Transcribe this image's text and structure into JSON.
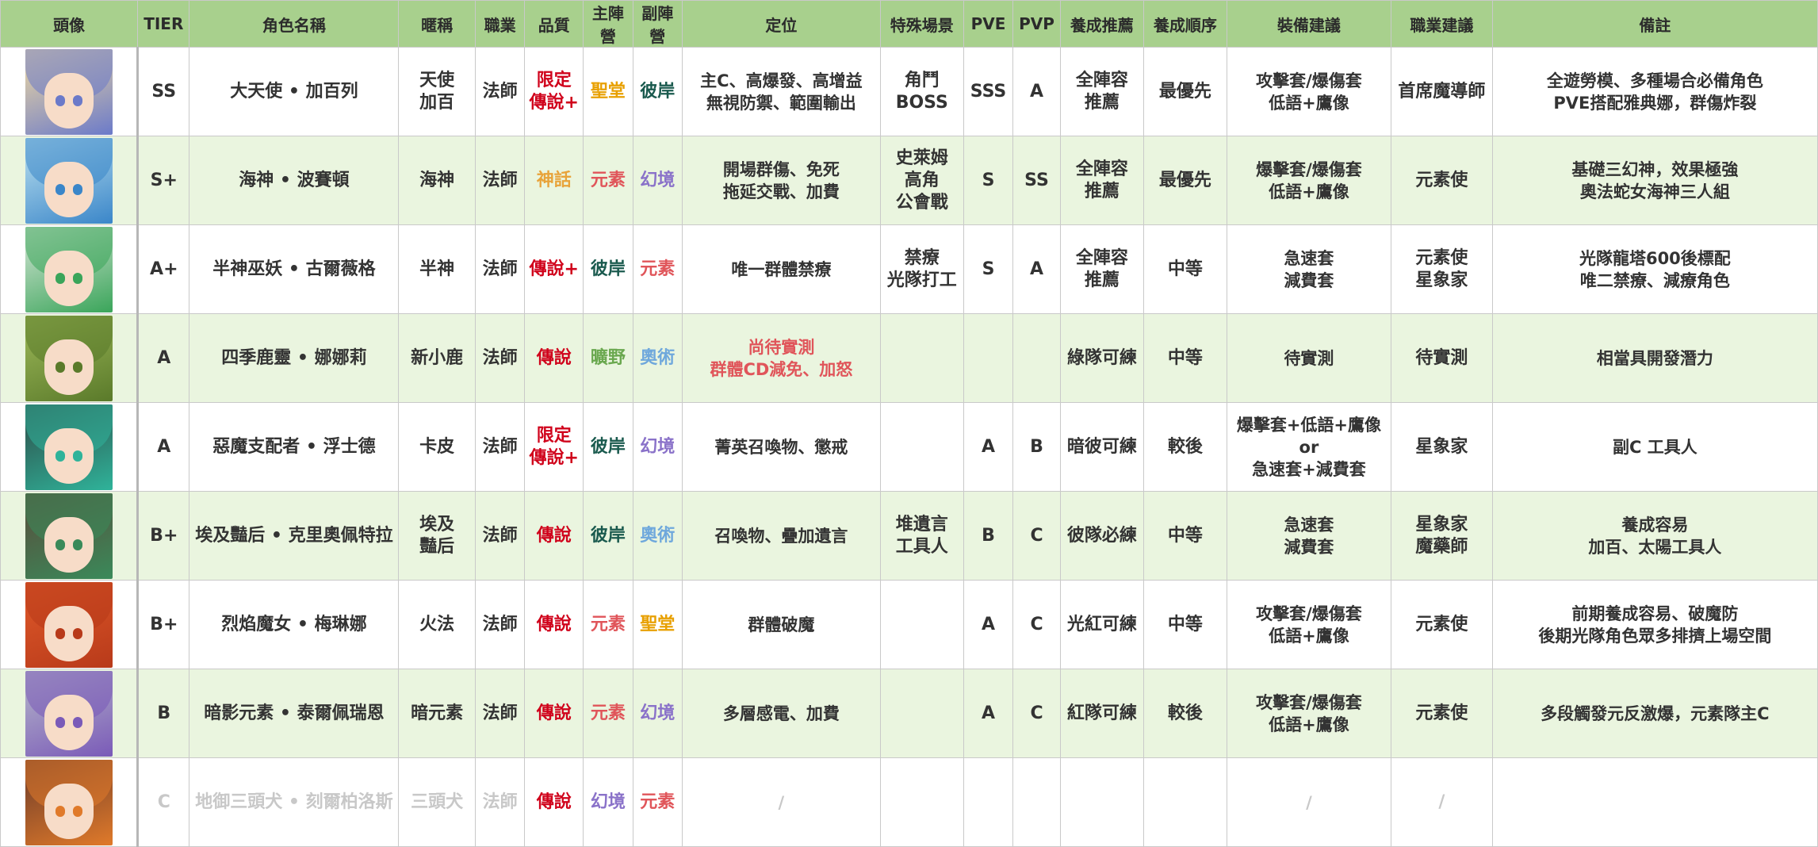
{
  "headers": [
    "頭像",
    "TIER",
    "角色名稱",
    "暱稱",
    "職業",
    "品質",
    "主陣營",
    "副陣營",
    "定位",
    "特殊場景",
    "PVE",
    "PVP",
    "養成推薦",
    "養成順序",
    "裝備建議",
    "職業建議",
    "備註"
  ],
  "rows": [
    {
      "avatar": "dark-angel-gabriel-portrait",
      "tier": "SS",
      "name": "大天使 • 加百列",
      "nick": "天使\n加百",
      "cls": "法師",
      "quality": "限定\n傳說+",
      "main": "聖堂",
      "sub": "彼岸",
      "role": "主C、高爆發、高增益\n無視防禦、範圍輸出",
      "special": "角鬥\nBOSS",
      "pve": "SSS",
      "pvp": "A",
      "rec": "全陣容\n推薦",
      "order": "最優先",
      "equip": "攻擊套/爆傷套\n低語+鷹像",
      "job": "首席魔導師",
      "note": "全遊勞模、多種場合必備角色\nPVE搭配雅典娜，群傷炸裂"
    },
    {
      "avatar": "poseidon-portrait",
      "tier": "S+",
      "name": "海神 • 波賽頓",
      "nick": "海神",
      "cls": "法師",
      "quality": "神話",
      "main": "元素",
      "sub": "幻境",
      "role": "開場群傷、免死\n拖延交戰、加費",
      "special": "史萊姆\n高角\n公會戰",
      "pve": "S",
      "pvp": "SS",
      "rec": "全陣容\n推薦",
      "order": "最優先",
      "equip": "爆擊套/爆傷套\n低語+鷹像",
      "job": "元素使",
      "note": "基礎三幻神，效果極強\n奧法蛇女海神三人組"
    },
    {
      "avatar": "gorgon-portrait",
      "tier": "A+",
      "name": "半神巫妖 • 古爾薇格",
      "nick": "半神",
      "cls": "法師",
      "quality": "傳說+",
      "main": "彼岸",
      "sub": "元素",
      "role": "唯一群體禁療",
      "special": "禁療\n光隊打工",
      "pve": "S",
      "pvp": "A",
      "rec": "全陣容\n推薦",
      "order": "中等",
      "equip": "急速套\n減費套",
      "job": "元素使\n星象家",
      "note": "光隊龍塔600後標配\n唯二禁療、減療角色"
    },
    {
      "avatar": "deer-spirit-portrait",
      "tier": "A",
      "name": "四季鹿靈 • 娜娜莉",
      "nick": "新小鹿",
      "cls": "法師",
      "quality": "傳說",
      "main": "曠野",
      "sub": "奧術",
      "role": "尚待實測\n群體CD減免、加怒",
      "special": "",
      "pve": "",
      "pvp": "",
      "rec": "綠隊可練",
      "order": "中等",
      "equip": "待實測",
      "job": "待實測",
      "note": "相當具開發潛力"
    },
    {
      "avatar": "faust-portrait",
      "tier": "A",
      "name": "惡魔支配者 • 浮士德",
      "nick": "卡皮",
      "cls": "法師",
      "quality": "限定\n傳說+",
      "main": "彼岸",
      "sub": "幻境",
      "role": "菁英召喚物、懲戒",
      "special": "",
      "pve": "A",
      "pvp": "B",
      "rec": "暗彼可練",
      "order": "較後",
      "equip": "爆擊套+低語+鷹像\nor\n急速套+減費套",
      "job": "星象家",
      "note": "副C 工具人"
    },
    {
      "avatar": "cleopatra-portrait",
      "tier": "B+",
      "name": "埃及豔后 • 克里奧佩特拉",
      "nick": "埃及\n豔后",
      "cls": "法師",
      "quality": "傳說",
      "main": "彼岸",
      "sub": "奧術",
      "role": "召喚物、疊加遺言",
      "special": "堆遺言\n工具人",
      "pve": "B",
      "pvp": "C",
      "rec": "彼隊必練",
      "order": "中等",
      "equip": "急速套\n減費套",
      "job": "星象家\n魔藥師",
      "note": "養成容易\n加百、太陽工具人"
    },
    {
      "avatar": "flame-witch-portrait",
      "tier": "B+",
      "name": "烈焰魔女 • 梅琳娜",
      "nick": "火法",
      "cls": "法師",
      "quality": "傳說",
      "main": "元素",
      "sub": "聖堂",
      "role": "群體破魔",
      "special": "",
      "pve": "A",
      "pvp": "C",
      "rec": "光紅可練",
      "order": "中等",
      "equip": "攻擊套/爆傷套\n低語+鷹像",
      "job": "元素使",
      "note": "前期養成容易、破魔防\n後期光隊角色眾多排擠上場空間"
    },
    {
      "avatar": "shadow-elemental-portrait",
      "tier": "B",
      "name": "暗影元素 • 泰爾佩瑞恩",
      "nick": "暗元素",
      "cls": "法師",
      "quality": "傳說",
      "main": "元素",
      "sub": "幻境",
      "role": "多層感電、加費",
      "special": "",
      "pve": "A",
      "pvp": "C",
      "rec": "紅隊可練",
      "order": "較後",
      "equip": "攻擊套/爆傷套\n低語+鷹像",
      "job": "元素使",
      "note": "多段觸發元反激爆，元素隊主C"
    },
    {
      "avatar": "cerberus-portrait",
      "tier": "C",
      "name": "地御三頭犬 • 刻爾柏洛斯",
      "nick": "三頭犬",
      "cls": "法師",
      "quality": "傳說",
      "main": "幻境",
      "sub": "元素",
      "role": "/",
      "special": "",
      "pve": "",
      "pvp": "",
      "rec": "",
      "order": "",
      "equip": "/",
      "job": "/",
      "note": ""
    }
  ],
  "colors": {
    "header_bg": "#a8d08d",
    "alt_row_bg": "#eaf5df",
    "quality_red": "#d0021b",
    "faction_sacred": "#e8a000",
    "faction_beyond": "#1a5a4e",
    "faction_element": "#e0555a",
    "faction_illusion": "#8a72c9",
    "faction_wild": "#6aa84f",
    "faction_arcane": "#6fa8dc",
    "myth_orange": "#e8a33a",
    "faded": "#c8c8c8"
  }
}
